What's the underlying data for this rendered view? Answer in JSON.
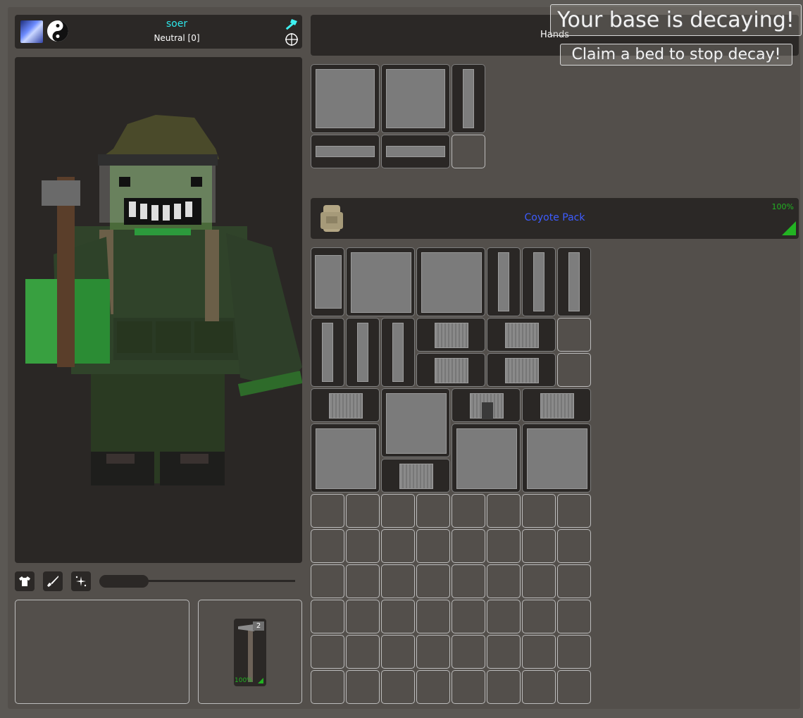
{
  "player": {
    "name": "soer",
    "reputation": "Neutral [0]",
    "name_color": "#2ee7ea"
  },
  "hands_label": "Hands",
  "notifications": {
    "decay": "Your base is decaying!",
    "claim": "Claim a bed to stop decay!"
  },
  "backpack": {
    "name": "Coyote Pack",
    "quality": "100%",
    "name_color": "#3d5cff",
    "quality_color": "#22b322"
  },
  "equipped_item": {
    "count": "2",
    "quality": "100%"
  },
  "tabs": [
    {
      "icon": "shirt-icon"
    },
    {
      "icon": "rifle-icon"
    },
    {
      "icon": "sparkle-icon"
    }
  ],
  "zoom_slider": {
    "value_fraction": 0.25
  }
}
